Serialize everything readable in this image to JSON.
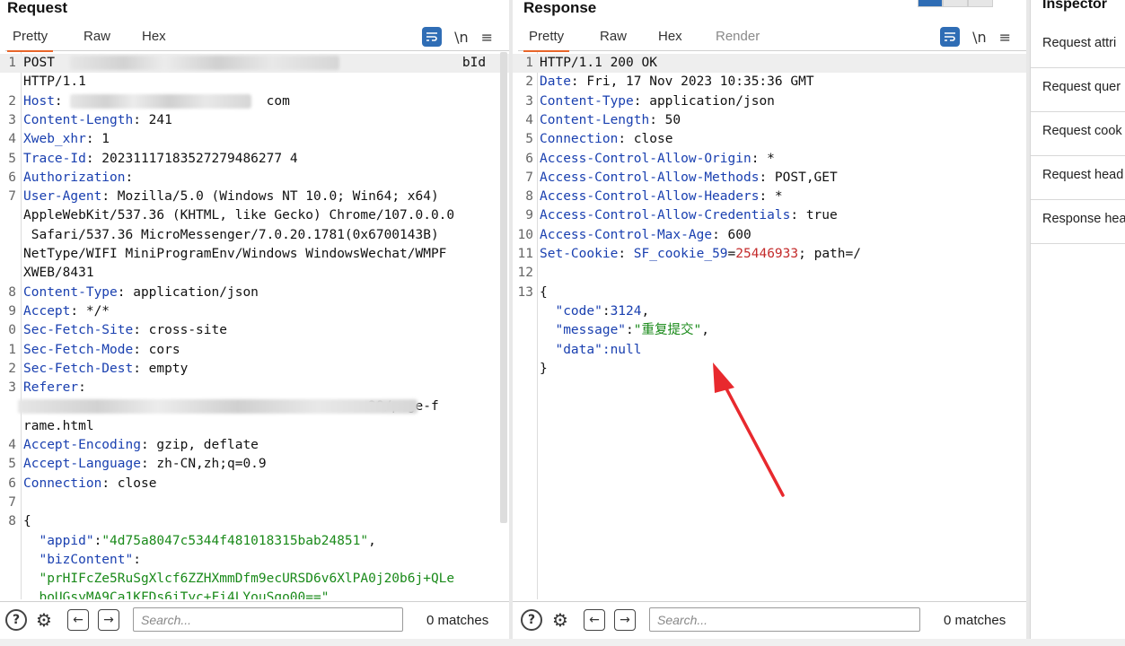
{
  "request": {
    "title": "Request",
    "tabs": [
      "Pretty",
      "Raw",
      "Hex"
    ],
    "lines": [
      {
        "n": "1",
        "segs": [
          {
            "t": "POST ",
            "c": ""
          },
          {
            "t": "                                                   ",
            "c": ""
          },
          {
            "t": "bId",
            "c": ""
          }
        ],
        "blur": [
          78,
          378
        ]
      },
      {
        "n": "",
        "segs": [
          {
            "t": "HTTP/1.1",
            "c": ""
          }
        ]
      },
      {
        "n": "2",
        "segs": [
          {
            "t": "Host",
            "c": "key"
          },
          {
            "t": ": ",
            "c": ""
          },
          {
            "t": "                         ",
            "c": ""
          },
          {
            "t": "com",
            "c": ""
          }
        ],
        "blur": [
          78,
          280
        ]
      },
      {
        "n": "3",
        "segs": [
          {
            "t": "Content-Length",
            "c": "key"
          },
          {
            "t": ": 241",
            "c": ""
          }
        ]
      },
      {
        "n": "4",
        "segs": [
          {
            "t": "Xweb_xhr",
            "c": "key"
          },
          {
            "t": ": 1",
            "c": ""
          }
        ]
      },
      {
        "n": "5",
        "segs": [
          {
            "t": "Trace-Id",
            "c": "key"
          },
          {
            "t": ": 20231117183527279486277 4",
            "c": ""
          }
        ]
      },
      {
        "n": "6",
        "segs": [
          {
            "t": "Authorization",
            "c": "key"
          },
          {
            "t": ":",
            "c": ""
          }
        ]
      },
      {
        "n": "7",
        "segs": [
          {
            "t": "User-Agent",
            "c": "key"
          },
          {
            "t": ": Mozilla/5.0 (Windows NT 10.0; Win64; x64)",
            "c": ""
          }
        ]
      },
      {
        "n": "",
        "segs": [
          {
            "t": "AppleWebKit/537.36 (KHTML, like Gecko) Chrome/107.0.0.0",
            "c": ""
          }
        ]
      },
      {
        "n": "",
        "segs": [
          {
            "t": " Safari/537.36 MicroMessenger/7.0.20.1781(0x6700143B)",
            "c": ""
          }
        ]
      },
      {
        "n": "",
        "segs": [
          {
            "t": "NetType/WIFI MiniProgramEnv/Windows WindowsWechat/WMPF",
            "c": ""
          }
        ]
      },
      {
        "n": "",
        "segs": [
          {
            "t": "XWEB/8431",
            "c": ""
          }
        ]
      },
      {
        "n": "8",
        "segs": [
          {
            "t": "Content-Type",
            "c": "key"
          },
          {
            "t": ": application/json",
            "c": ""
          }
        ]
      },
      {
        "n": "9",
        "segs": [
          {
            "t": "Accept",
            "c": "key"
          },
          {
            "t": ": */*",
            "c": ""
          }
        ]
      },
      {
        "n": "0",
        "segs": [
          {
            "t": "Sec-Fetch-Site",
            "c": "key"
          },
          {
            "t": ": cross-site",
            "c": ""
          }
        ]
      },
      {
        "n": "1",
        "segs": [
          {
            "t": "Sec-Fetch-Mode",
            "c": "key"
          },
          {
            "t": ": cors",
            "c": ""
          }
        ]
      },
      {
        "n": "2",
        "segs": [
          {
            "t": "Sec-Fetch-Dest",
            "c": "key"
          },
          {
            "t": ": empty",
            "c": ""
          }
        ]
      },
      {
        "n": "3",
        "segs": [
          {
            "t": "Referer",
            "c": "key"
          },
          {
            "t": ":",
            "c": ""
          }
        ]
      },
      {
        "n": "",
        "segs": [
          {
            "t": "                                            ",
            "c": ""
          },
          {
            "t": "28/page-f",
            "c": ""
          }
        ],
        "blur": [
          20,
          465
        ]
      },
      {
        "n": "",
        "segs": [
          {
            "t": "rame.html",
            "c": ""
          }
        ]
      },
      {
        "n": "4",
        "segs": [
          {
            "t": "Accept-Encoding",
            "c": "key"
          },
          {
            "t": ": gzip, deflate",
            "c": ""
          }
        ]
      },
      {
        "n": "5",
        "segs": [
          {
            "t": "Accept-Language",
            "c": "key"
          },
          {
            "t": ": zh-CN,zh;q=0.9",
            "c": ""
          }
        ]
      },
      {
        "n": "6",
        "segs": [
          {
            "t": "Connection",
            "c": "key"
          },
          {
            "t": ": close",
            "c": ""
          }
        ]
      },
      {
        "n": "7",
        "segs": []
      },
      {
        "n": "8",
        "segs": [
          {
            "t": "{",
            "c": ""
          }
        ]
      },
      {
        "n": "",
        "segs": [
          {
            "t": "  \"appid\"",
            "c": "jkey"
          },
          {
            "t": ":",
            "c": ""
          },
          {
            "t": "\"4d75a8047c5344f481018315bab24851\"",
            "c": "jstr"
          },
          {
            "t": ",",
            "c": ""
          }
        ]
      },
      {
        "n": "",
        "segs": [
          {
            "t": "  \"bizContent\"",
            "c": "jkey"
          },
          {
            "t": ":",
            "c": ""
          }
        ]
      },
      {
        "n": "",
        "segs": [
          {
            "t": "  \"prHIFcZe5RuSgXlcf6ZZHXmmDfm9ecURSD6v6XlPA0j20b6j+QLe",
            "c": "jstr"
          }
        ]
      },
      {
        "n": "",
        "segs": [
          {
            "t": "  boUGsyMA9Ca1KFDs6iTyc+Fi4LYouSgo00==\"",
            "c": "jstr"
          }
        ]
      }
    ],
    "search_placeholder": "Search...",
    "matches": "0 matches"
  },
  "response": {
    "title": "Response",
    "tabs": [
      "Pretty",
      "Raw",
      "Hex",
      "Render"
    ],
    "lines": [
      {
        "n": "1",
        "segs": [
          {
            "t": "HTTP/1.1 200 OK",
            "c": ""
          }
        ]
      },
      {
        "n": "2",
        "segs": [
          {
            "t": "Date",
            "c": "key"
          },
          {
            "t": ": Fri, 17 Nov 2023 10:35:36 GMT",
            "c": ""
          }
        ]
      },
      {
        "n": "3",
        "segs": [
          {
            "t": "Content-Type",
            "c": "key"
          },
          {
            "t": ": application/json",
            "c": ""
          }
        ]
      },
      {
        "n": "4",
        "segs": [
          {
            "t": "Content-Length",
            "c": "key"
          },
          {
            "t": ": 50",
            "c": ""
          }
        ]
      },
      {
        "n": "5",
        "segs": [
          {
            "t": "Connection",
            "c": "key"
          },
          {
            "t": ": close",
            "c": ""
          }
        ]
      },
      {
        "n": "6",
        "segs": [
          {
            "t": "Access-Control-Allow-Origin",
            "c": "key"
          },
          {
            "t": ": *",
            "c": ""
          }
        ]
      },
      {
        "n": "7",
        "segs": [
          {
            "t": "Access-Control-Allow-Methods",
            "c": "key"
          },
          {
            "t": ": POST,GET",
            "c": ""
          }
        ]
      },
      {
        "n": "8",
        "segs": [
          {
            "t": "Access-Control-Allow-Headers",
            "c": "key"
          },
          {
            "t": ": *",
            "c": ""
          }
        ]
      },
      {
        "n": "9",
        "segs": [
          {
            "t": "Access-Control-Allow-Credentials",
            "c": "key"
          },
          {
            "t": ": true",
            "c": ""
          }
        ]
      },
      {
        "n": "10",
        "segs": [
          {
            "t": "Access-Control-Max-Age",
            "c": "key"
          },
          {
            "t": ": 600",
            "c": ""
          }
        ]
      },
      {
        "n": "11",
        "segs": [
          {
            "t": "Set-Cookie",
            "c": "key"
          },
          {
            "t": ": ",
            "c": ""
          },
          {
            "t": "SF_cookie_59",
            "c": "cookie"
          },
          {
            "t": "=",
            "c": ""
          },
          {
            "t": "25446933",
            "c": "red"
          },
          {
            "t": "; path=/",
            "c": ""
          }
        ]
      },
      {
        "n": "12",
        "segs": []
      },
      {
        "n": "13",
        "segs": [
          {
            "t": "{",
            "c": ""
          }
        ]
      },
      {
        "n": "",
        "segs": [
          {
            "t": "  \"code\"",
            "c": "jkey"
          },
          {
            "t": ":",
            "c": ""
          },
          {
            "t": "3124",
            "c": "jnum"
          },
          {
            "t": ",",
            "c": ""
          }
        ]
      },
      {
        "n": "",
        "segs": [
          {
            "t": "  \"message\"",
            "c": "jkey"
          },
          {
            "t": ":",
            "c": ""
          },
          {
            "t": "\"重复提交\"",
            "c": "jstr"
          },
          {
            "t": ",",
            "c": ""
          }
        ]
      },
      {
        "n": "",
        "segs": [
          {
            "t": "  \"data\"",
            "c": "jkey"
          },
          {
            "t": ":null",
            "c": "jnum"
          }
        ]
      },
      {
        "n": "",
        "segs": [
          {
            "t": "}",
            "c": ""
          }
        ]
      }
    ],
    "search_placeholder": "Search...",
    "matches": "0 matches"
  },
  "inspector": {
    "title": "Inspector",
    "items": [
      "Request attri",
      "Request quer",
      "Request cook",
      "Request head",
      "Response hea"
    ]
  },
  "colors": {
    "accent_tab": "#e8652a",
    "key_blue": "#1a40b0",
    "json_green": "#1a8a1a",
    "value_red": "#c42b2b",
    "arrow_red": "#e8292e"
  },
  "icons": {
    "wrap": "wrap-lines-icon",
    "newline": "newline-icon",
    "menu": "menu-icon",
    "help": "help-icon",
    "settings": "gear-icon",
    "back": "arrow-left-icon",
    "forward": "arrow-right-icon"
  }
}
